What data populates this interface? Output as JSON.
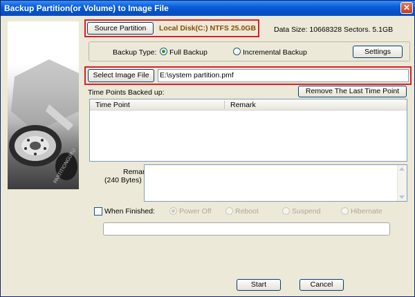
{
  "window": {
    "title": "Backup Partition(or Volume) to Image File",
    "close_glyph": "✕"
  },
  "source": {
    "button_label": "Source Partition",
    "value": "Local Disk(C:) NTFS 25.0GB",
    "data_size": "Data Size: 10668328 Sectors. 5.1GB"
  },
  "backup_type": {
    "label": "Backup Type:",
    "options": [
      {
        "label": "Full Backup",
        "checked": true
      },
      {
        "label": "Incremental Backup",
        "checked": false
      }
    ],
    "settings_label": "Settings"
  },
  "image_file": {
    "button_label": "Select Image File",
    "path": "E:\\system partition.pmf"
  },
  "time_points": {
    "label": "Time Points Backed up:",
    "remove_label": "Remove The Last Time Point",
    "columns": [
      "Time Point",
      "Remark"
    ]
  },
  "remark": {
    "label": "Remark:",
    "sub_label": "(240 Bytes)"
  },
  "when_finished": {
    "label": "When Finished:",
    "options": [
      {
        "label": "Power Off",
        "checked": true
      },
      {
        "label": "Reboot",
        "checked": false
      },
      {
        "label": "Suspend",
        "checked": false
      },
      {
        "label": "Hibernate",
        "checked": false
      }
    ]
  },
  "footer": {
    "start_label": "Start",
    "cancel_label": "Cancel"
  },
  "colors": {
    "title_bar": "#0550c8",
    "highlight_border": "#e01b24",
    "source_value": "#8b4c00"
  }
}
